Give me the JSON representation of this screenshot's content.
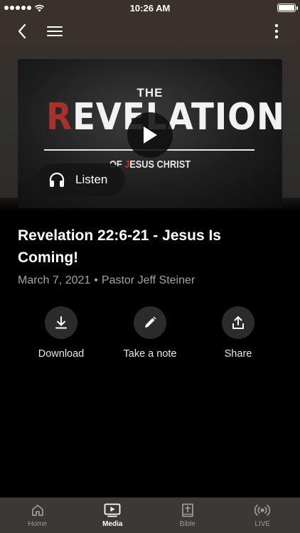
{
  "status_bar": {
    "time": "10:26 AM",
    "signal_icon": "signal-dots-icon",
    "wifi_icon": "wifi-icon",
    "battery_icon": "battery-icon",
    "battery_level": 1.0
  },
  "nav": {
    "back_icon": "chevron-left-icon",
    "menu_icon": "hamburger-menu-icon",
    "more_icon": "more-vertical-icon"
  },
  "thumbnail": {
    "line1": "THE",
    "line2_first": "R",
    "line2_rest": "EVELATION",
    "line3_a": "OF ",
    "line3_j": "J",
    "line3_b": "ESUS CHRIST"
  },
  "play_icon": "play-icon",
  "listen": {
    "label": "Listen",
    "icon": "headphones-icon"
  },
  "sermon": {
    "title": "Revelation 22:6-21 - Jesus Is Coming!",
    "date": "March 7, 2021",
    "separator": "•",
    "speaker": "Pastor Jeff Steiner"
  },
  "actions": [
    {
      "label": "Download",
      "icon": "download-icon"
    },
    {
      "label": "Take a note",
      "icon": "pencil-icon"
    },
    {
      "label": "Share",
      "icon": "share-icon"
    }
  ],
  "tabs": [
    {
      "label": "Home",
      "icon": "home-icon",
      "active": false
    },
    {
      "label": "Media",
      "icon": "media-play-icon",
      "active": true
    },
    {
      "label": "Bible",
      "icon": "bible-icon",
      "active": false
    },
    {
      "label": "LIVE",
      "icon": "live-broadcast-icon",
      "active": false
    }
  ],
  "colors": {
    "accent_red": "#a9302d",
    "header_bg": "#3a312c",
    "tabbar_bg": "#3b3836",
    "meta_text": "#a3a3a3"
  }
}
